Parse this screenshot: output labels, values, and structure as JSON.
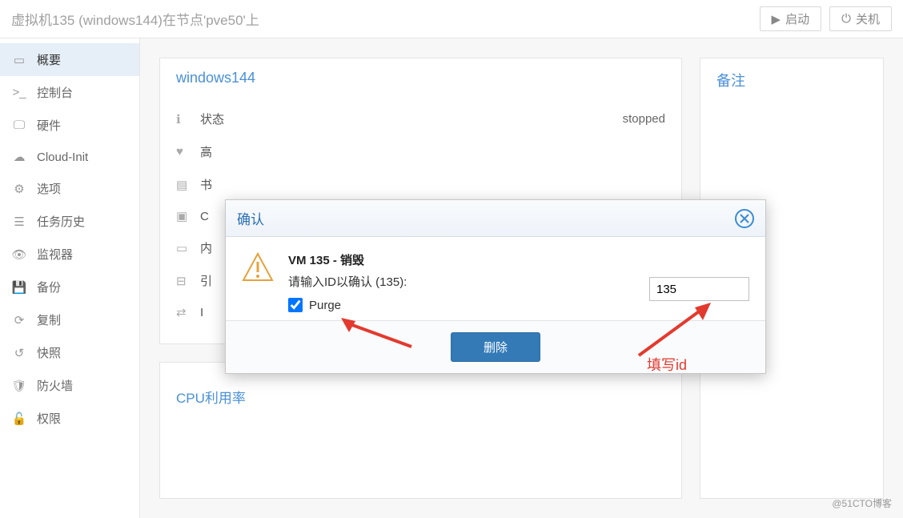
{
  "header": {
    "title": "虚拟机135 (windows144)在节点'pve50'上",
    "start_label": "启动",
    "shutdown_label": "关机"
  },
  "sidebar": {
    "items": [
      {
        "label": "概要"
      },
      {
        "label": "控制台"
      },
      {
        "label": "硬件"
      },
      {
        "label": "Cloud-Init"
      },
      {
        "label": "选项"
      },
      {
        "label": "任务历史"
      },
      {
        "label": "监视器"
      },
      {
        "label": "备份"
      },
      {
        "label": "复制"
      },
      {
        "label": "快照"
      },
      {
        "label": "防火墙"
      },
      {
        "label": "权限"
      }
    ]
  },
  "summary": {
    "vm_name": "windows144",
    "rows": [
      {
        "label": "状态",
        "value": "stopped"
      }
    ],
    "other_rows": [
      "高",
      "书",
      "C",
      "内",
      "引",
      "I"
    ],
    "notes_heading": "备注",
    "cpu_heading": "CPU利用率"
  },
  "modal": {
    "title": "确认",
    "line1": "VM 135 - 销毁",
    "line2": "请输入ID以确认 (135):",
    "purge_label": "Purge",
    "purge_checked": true,
    "id_value": "135",
    "delete_label": "删除"
  },
  "annotations": {
    "fill_id_label": "填写id"
  },
  "watermark": "@51CTO博客"
}
